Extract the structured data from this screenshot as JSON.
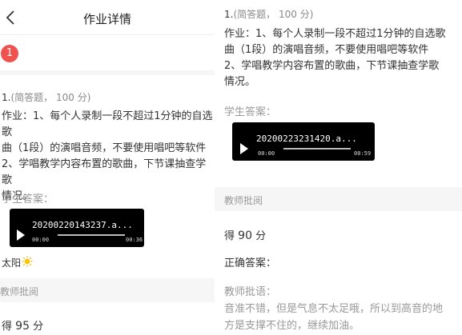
{
  "left": {
    "nav": {
      "title": "作业详情",
      "back_icon": "chevron-left-icon"
    },
    "question_badge": "1",
    "question": {
      "number": "1.",
      "type": "(简答题，",
      "points": "100 分)",
      "lines": [
        "作业：1、每个人录制一段不超过1分钟的自选歌",
        "曲（1段）的演唱音频，不要使用唱吧等软件",
        "2、学唱教学内容布置的歌曲，下节课抽查学歌",
        "情况。"
      ]
    },
    "answer_label": "学生答案：",
    "audio": {
      "filename": "20200220143237.a...",
      "current_time": "00:00",
      "duration": "00:36",
      "progress": 0
    },
    "note": "太阳",
    "sun_icon": "sun-emoji-icon",
    "review_label": "教师批阅",
    "score": {
      "prefix": "得",
      "value": "95",
      "unit": "分"
    }
  },
  "right": {
    "question": {
      "number": "1.",
      "type": "(简答题，",
      "points": "100 分)",
      "lines": [
        "作业：1、每个人录制一段不超过1分钟的自选歌",
        "曲（1段）的演唱音频，不要使用唱吧等软件",
        "2、学唱教学内容布置的歌曲，下节课抽查学歌",
        "情况。"
      ]
    },
    "answer_label": "学生答案：",
    "audio": {
      "filename": "20200223231420.a...",
      "current_time": "00:00",
      "duration": "00:59",
      "progress": 0
    },
    "review_label": "教师批阅",
    "score": {
      "prefix": "得",
      "value": "90",
      "unit": "分"
    },
    "correct_answer_label": "正确答案：",
    "comment_label": "教师批语：",
    "comment_lines": [
      "音准不错，但是气息不太足哦，所以到高音的地",
      "方是支撑不住的，继续加油。"
    ]
  },
  "colors": {
    "badge": "#f0524f",
    "band": "#f6f6f6",
    "muted": "#999999",
    "player": "#000000"
  }
}
